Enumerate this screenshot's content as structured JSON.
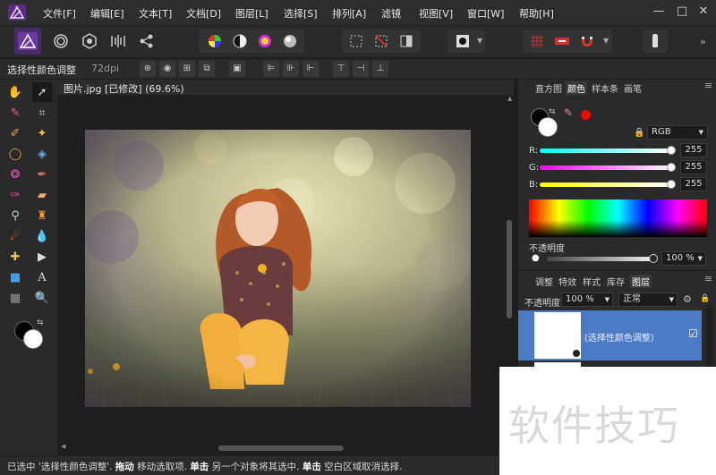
{
  "menu": [
    "文件[F]",
    "编辑[E]",
    "文本[T]",
    "文档[D]",
    "图层[L]",
    "选择[S]",
    "排列[A]",
    "滤镜",
    "视图[V]",
    "窗口[W]",
    "帮助[H]"
  ],
  "context": {
    "tool_name": "选择性颜色调整",
    "dpi": "72dpi"
  },
  "document": {
    "title": "图片.jpg [已修改] (69.6%)"
  },
  "color_panel": {
    "tabs": [
      "直方图",
      "颜色",
      "样本条",
      "画笔"
    ],
    "active_tab": "颜色",
    "model": "RGB",
    "r_label": "R:",
    "r_value": "255",
    "g_label": "G:",
    "g_value": "255",
    "b_label": "B:",
    "b_value": "255",
    "opacity_label": "不透明度",
    "opacity_value": "100 %",
    "swatch_accent": "#ff0000"
  },
  "layers_panel": {
    "tabs": [
      "调整",
      "特效",
      "样式",
      "库存",
      "图层"
    ],
    "active_tab": "图层",
    "opacity_label": "不透明度:",
    "opacity_value": "100 %",
    "blend_mode": "正常",
    "layers": [
      {
        "name": "(选择性颜色调整)",
        "checked": "☑"
      }
    ],
    "selected_color": "#4a7bc4"
  },
  "status": {
    "part1": "已选中 '选择性颜色调整'. ",
    "drag_label": "拖动",
    "part2": " 移动选取项. ",
    "click_label": "单击",
    "part3": " 另一个对象将其选中. ",
    "click2_label": "单击",
    "part4": " 空白区域取消选择."
  },
  "watermark": "软件技巧"
}
